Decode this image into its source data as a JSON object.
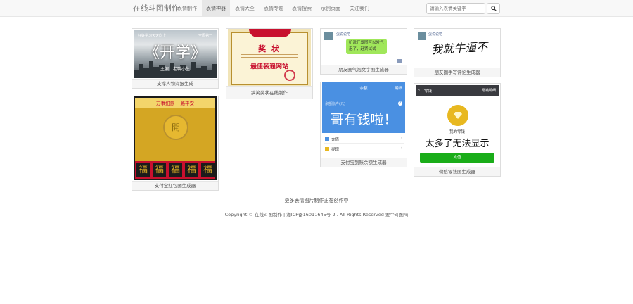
{
  "nav": {
    "brand": "在线斗图制作",
    "items": [
      "表情制作",
      "表情神器",
      "表情大全",
      "表情专题",
      "表情搜索",
      "示例页面",
      "关注我们"
    ],
    "active_index": 1,
    "search_placeholder": "请输入表情关键字"
  },
  "cards": [
    {
      "caption": "支撑人物海报生成",
      "thumb": {
        "banner_left": "好好学习天天向上",
        "banner_right": "全国第一",
        "headline": "《开学》",
        "subtitle": "主演：老鸭小生"
      }
    },
    {
      "caption": "搞笑奖状在线制作",
      "thumb": {
        "title": "奖 状",
        "award": "最佳装逼网站"
      }
    },
    {
      "caption": "朋友圈气泡文字图生成器",
      "thumb": {
        "user": "蛋说说吧",
        "bubble": "听说开发图可以发气泡了，赶紧试试"
      }
    },
    {
      "caption": "朋友圈手写评论生成器",
      "thumb": {
        "user": "蛋说说吧",
        "handwriting": "我就牛逼不"
      }
    },
    {
      "caption": "支付宝到账余额生成器",
      "thumb": {
        "header": "余额",
        "header_right": "明细",
        "label": "余额账户(元)",
        "headline": "哥有钱啦！",
        "row1": "充值",
        "row2": "提现"
      }
    },
    {
      "caption": "微信零钱图生成器",
      "thumb": {
        "header": "零钱",
        "header_right": "零钱明细",
        "label": "我的零钱",
        "headline": "太多了无法显示",
        "button": "充值"
      }
    },
    {
      "caption": "支付宝红包图生成器",
      "thumb": {
        "banner": "万事如意 一路平安",
        "coin": "開",
        "chars": [
          "福",
          "福",
          "福",
          "福",
          "福"
        ]
      }
    }
  ],
  "footer": {
    "link": "更多表情图片制作正在创作中",
    "copyright": "Copyright © 在线斗图制作 | 湘ICP备16011645号-2 . All Rights Reserved 要个斗图吗"
  },
  "colors": {
    "navbar_bg": "#f8f8f8",
    "alipay_blue": "#4a90e2",
    "wechat_green": "#1aad19",
    "red_packet": "#c8102e",
    "gold": "#e8b820"
  }
}
